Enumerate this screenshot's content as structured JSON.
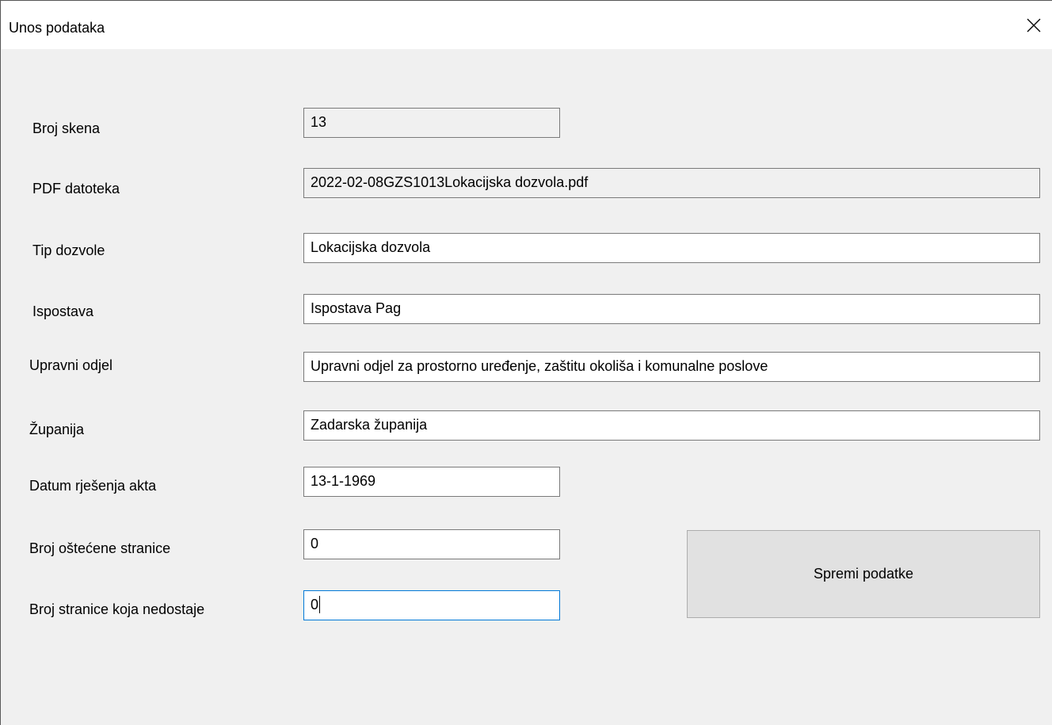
{
  "window": {
    "title": "Unos podataka"
  },
  "form": {
    "broj_skena": {
      "label": "Broj skena",
      "value": "13"
    },
    "pdf_datoteka": {
      "label": "PDF datoteka",
      "value": "2022-02-08GZS1013Lokacijska dozvola.pdf"
    },
    "tip_dozvole": {
      "label": "Tip dozvole",
      "value": "Lokacijska dozvola"
    },
    "ispostava": {
      "label": "Ispostava",
      "value": "Ispostava Pag"
    },
    "upravni_odjel": {
      "label": "Upravni odjel",
      "value": "Upravni odjel za prostorno uređenje, zaštitu okoliša i komunalne poslove"
    },
    "zupanija": {
      "label": "Županija",
      "value": "Zadarska županija"
    },
    "datum": {
      "label": "Datum rješenja akta",
      "value": "13-1-1969"
    },
    "ostecena": {
      "label": "Broj oštećene stranice",
      "value": "0"
    },
    "nedostaje": {
      "label": "Broj stranice koja nedostaje",
      "value": "0"
    }
  },
  "buttons": {
    "save_label": "Spremi podatke"
  },
  "icons": {
    "close": "close-icon"
  }
}
